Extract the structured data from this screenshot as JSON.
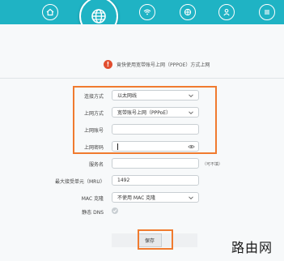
{
  "nav": {
    "items": [
      "home-icon",
      "globe-icon",
      "wifi-icon",
      "router-icon",
      "user-icon",
      "menu-icon"
    ]
  },
  "notice": {
    "text": "竟快使用宽带账号上网（PPPOE）方式上网"
  },
  "form": {
    "connection_type": {
      "label": "连接方式",
      "value": "以太网线"
    },
    "internet_mode": {
      "label": "上网方式",
      "value": "宽带账号上网（PPPoE）"
    },
    "account": {
      "label": "上网账号",
      "value": ""
    },
    "password": {
      "label": "上网密码",
      "value": ""
    },
    "service_name": {
      "label": "服务名",
      "value": "",
      "hint": "（可不填）"
    },
    "mru": {
      "label": "最大接受单元（MRU）",
      "value": "1492"
    },
    "mac_clone": {
      "label": "MAC 克隆",
      "value": "不使用 MAC 克隆"
    },
    "static_dns": {
      "label": "静态 DNS"
    }
  },
  "save_label": "保存",
  "watermark": "路由网",
  "colors": {
    "accent": "#1fb3c4",
    "highlight": "#f07b2f",
    "warning": "#e14e2f"
  }
}
